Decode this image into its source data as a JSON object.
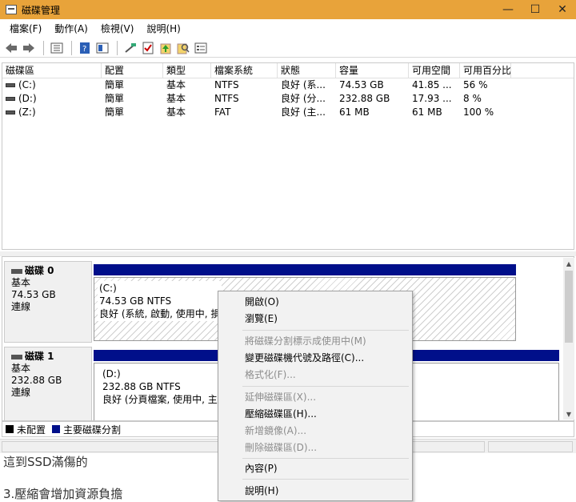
{
  "window": {
    "title": "磁碟管理",
    "min": "—",
    "max": "☐",
    "close": "✕"
  },
  "menu": [
    "檔案(F)",
    "動作(A)",
    "檢視(V)",
    "說明(H)"
  ],
  "toolbar_icons": [
    "back-icon",
    "forward-icon",
    "properties-icon",
    "help-icon",
    "view-icon",
    "connect-icon",
    "check-icon",
    "up-icon",
    "search-icon",
    "list-icon"
  ],
  "volume_list": {
    "columns": [
      "磁碟區",
      "配置",
      "類型",
      "檔案系統",
      "狀態",
      "容量",
      "可用空間",
      "可用百分比"
    ],
    "rows": [
      [
        "(C:)",
        "簡單",
        "基本",
        "NTFS",
        "良好 (系...",
        "74.53 GB",
        "41.85 ...",
        "56 %"
      ],
      [
        "(D:)",
        "簡單",
        "基本",
        "NTFS",
        "良好 (分...",
        "232.88 GB",
        "17.93 ...",
        "8 %"
      ],
      [
        "(Z:)",
        "簡單",
        "基本",
        "FAT",
        "良好 (主...",
        "61 MB",
        "61 MB",
        "100 %"
      ]
    ]
  },
  "disks": [
    {
      "name": "磁碟 0",
      "type": "基本",
      "size": "74.53 GB",
      "status": "連線",
      "partition": {
        "letter": "(C:)",
        "info": "74.53 GB NTFS",
        "state": "良好 (系統, 啟動, 使用中, 損"
      }
    },
    {
      "name": "磁碟 1",
      "type": "基本",
      "size": "232.88 GB",
      "status": "連線",
      "partition": {
        "letter": "(D:)",
        "info": "232.88 GB NTFS",
        "state": "良好 (分頁檔案, 使用中, 主要"
      }
    }
  ],
  "legend": [
    {
      "label": "未配置",
      "color": "#000000"
    },
    {
      "label": "主要磁碟分割",
      "color": "#000f8a"
    }
  ],
  "background_text": [
    "這到SSD滿傷的",
    "3.壓縮會增加資源負擔"
  ],
  "context_menu": [
    {
      "label": "開啟(O)",
      "enabled": true
    },
    {
      "label": "瀏覽(E)",
      "enabled": true
    },
    {
      "label": "將磁碟分割標示成使用中(M)",
      "enabled": false
    },
    {
      "label": "變更磁碟機代號及路徑(C)...",
      "enabled": true
    },
    {
      "label": "格式化(F)...",
      "enabled": false
    },
    {
      "label": "延伸磁碟區(X)...",
      "enabled": false
    },
    {
      "label": "壓縮磁碟區(H)...",
      "enabled": true
    },
    {
      "label": "新增鏡像(A)...",
      "enabled": false
    },
    {
      "label": "刪除磁碟區(D)...",
      "enabled": false
    },
    {
      "label": "內容(P)",
      "enabled": true
    },
    {
      "label": "說明(H)",
      "enabled": true
    }
  ]
}
